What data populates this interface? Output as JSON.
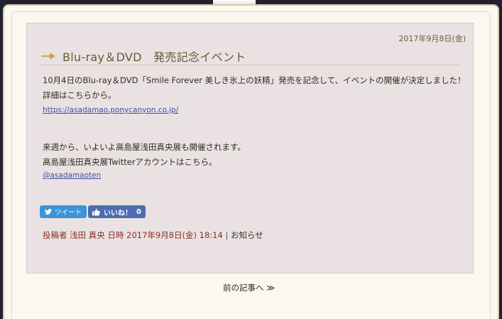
{
  "post": {
    "date": "2017年9月8日(金)",
    "title": "Blu-ray＆DVD　発売記念イベント",
    "line1": "10月4日のBlu-ray＆DVD「Smile Forever 美しき氷上の妖精」発売を記念して、イベントの開催が決定しました！",
    "line2": "詳細はこちらから。",
    "link1": "https://asadamao.ponycanyon.co.jp/",
    "line3": "来週から、いよいよ高島屋浅田真央展も開催されます。",
    "line4": "高島屋浅田真央展Twitterアカウントはこちら。",
    "link2": "@asadamaoten"
  },
  "share": {
    "tweet_label": "ツイート",
    "like_label": "いいね！",
    "like_count": "0"
  },
  "meta": {
    "author_label": "投稿者 浅田 真央 日時 2017年9月8日(金) 18:14",
    "separator": "|",
    "category": "お知らせ"
  },
  "nav": {
    "prev_label": "前の記事へ ≫"
  },
  "colors": {
    "background_dark": "#1f2233",
    "frame": "#fbf8ef",
    "article_bg": "#eae2e2",
    "title": "#6b5838",
    "meta": "#8a2e22",
    "tweet": "#3c94d8",
    "like": "#4d6bb0"
  }
}
